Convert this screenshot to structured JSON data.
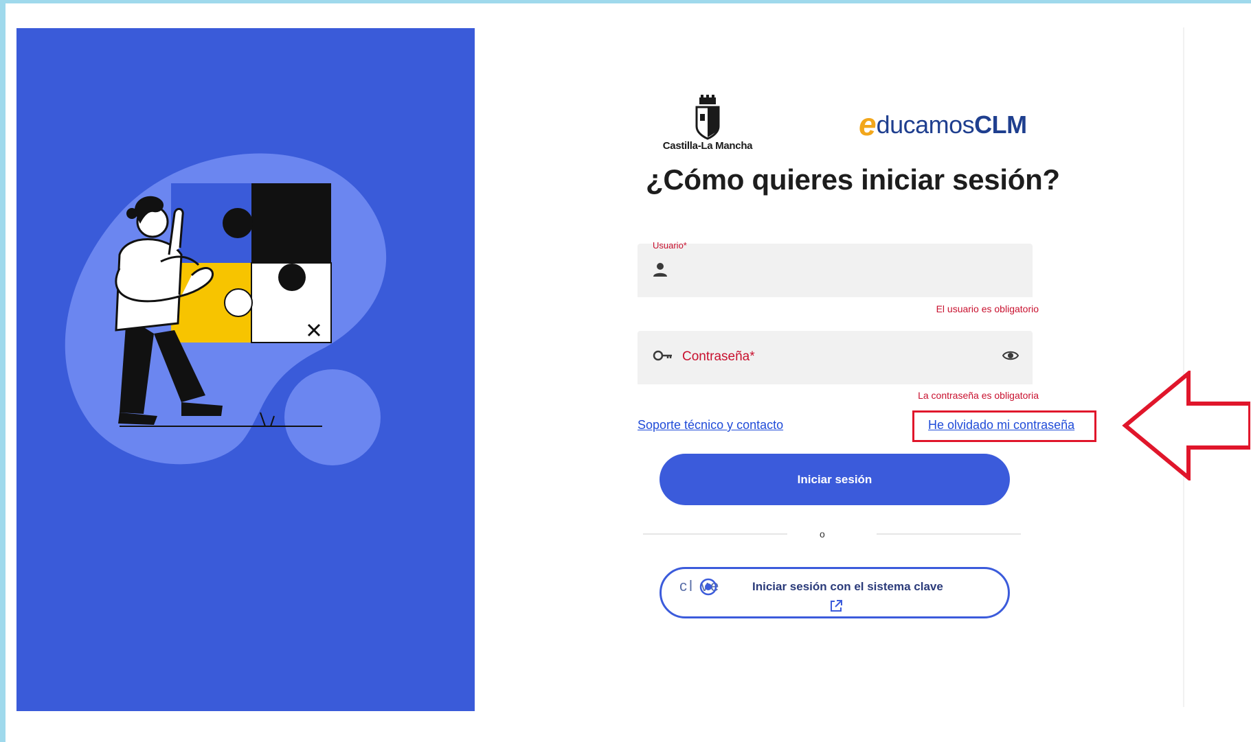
{
  "branding": {
    "region_logo_caption": "Castilla-La Mancha",
    "app_logo_letter": "e",
    "app_logo_word": "ducamos",
    "app_logo_bold": "CLM"
  },
  "page": {
    "title": "¿Cómo quieres iniciar sesión?"
  },
  "form": {
    "user_field": {
      "label": "Usuario*",
      "value": "",
      "error": "El usuario es obligatorio",
      "icon": "person-icon"
    },
    "password_field": {
      "placeholder": "Contraseña*",
      "value": "",
      "error": "La contraseña es obligatoria",
      "icon": "key-icon",
      "toggle_icon": "eye-icon"
    },
    "support_link": "Soporte técnico y contacto",
    "forgot_link": "He olvidado mi contraseña",
    "login_button": "Iniciar sesión",
    "separator": "o",
    "clave_logo": "cl  ve",
    "clave_button": "Iniciar sesión con el sistema clave",
    "clave_icon": "external-link-icon"
  },
  "colors": {
    "hero_background": "#3a5bd9",
    "primary": "#3b5bdb",
    "error": "#c8102e",
    "highlight": "#e0162b"
  }
}
